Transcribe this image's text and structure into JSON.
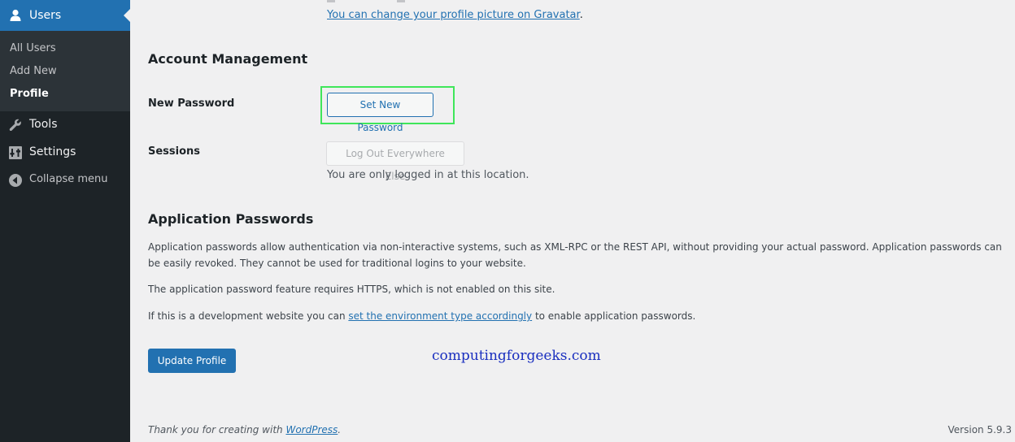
{
  "sidebar": {
    "current_menu": "Users",
    "submenu": [
      "All Users",
      "Add New",
      "Profile"
    ],
    "items": [
      "Tools",
      "Settings",
      "Collapse menu"
    ]
  },
  "profile_picture": {
    "gravatar_link": "You can change your profile picture on Gravatar",
    "gravatar_suffix": "."
  },
  "account_management": {
    "heading": "Account Management",
    "new_password_label": "New Password",
    "set_password_button": "Set New Password",
    "sessions_label": "Sessions",
    "logout_button": "Log Out Everywhere Else",
    "sessions_note": "You are only logged in at this location."
  },
  "application_passwords": {
    "heading": "Application Passwords",
    "para1": "Application passwords allow authentication via non-interactive systems, such as XML-RPC or the REST API, without providing your actual password. Application passwords can be easily revoked. They cannot be used for traditional logins to your website.",
    "para2": "The application password feature requires HTTPS, which is not enabled on this site.",
    "para3_prefix": "If this is a development website you can ",
    "para3_link": "set the environment type accordingly",
    "para3_suffix": " to enable application passwords."
  },
  "update_button": "Update Profile",
  "watermark": "computingforgeeks.com",
  "footer": {
    "thanks_prefix": "Thank you for creating with ",
    "thanks_link": "WordPress",
    "thanks_suffix": ".",
    "version": "Version 5.9.3"
  },
  "colors": {
    "accent": "#2271b1",
    "sidebar_bg": "#1d2327",
    "highlight": "#3fe65a"
  }
}
